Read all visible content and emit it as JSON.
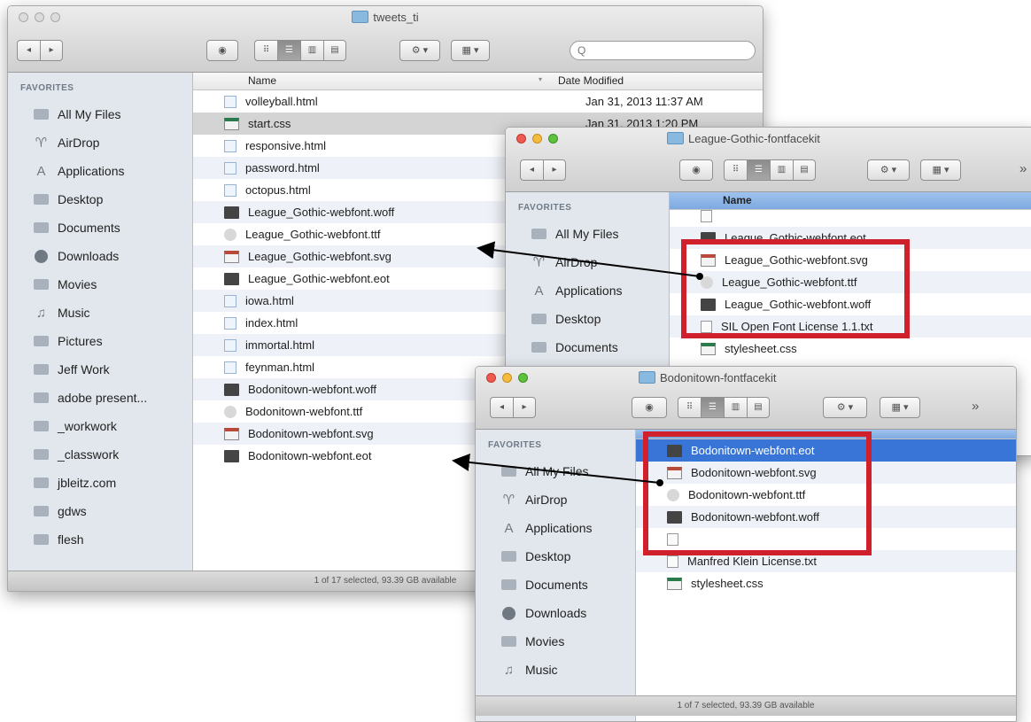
{
  "colors": {
    "highlight": "#d0202c",
    "selection": "#3875d7",
    "arrow": "#000000"
  },
  "windows": {
    "tweets": {
      "title": "tweets_ti",
      "search_placeholder": "Q",
      "favorites": "FAVORITES",
      "col_name": "Name",
      "col_date": "Date Modified",
      "sidebar": [
        {
          "label": "All My Files",
          "icon": "all-files-icon"
        },
        {
          "label": "AirDrop",
          "icon": "airdrop-icon"
        },
        {
          "label": "Applications",
          "icon": "applications-icon"
        },
        {
          "label": "Desktop",
          "icon": "desktop-icon"
        },
        {
          "label": "Documents",
          "icon": "documents-icon"
        },
        {
          "label": "Downloads",
          "icon": "downloads-icon"
        },
        {
          "label": "Movies",
          "icon": "movies-icon"
        },
        {
          "label": "Music",
          "icon": "music-icon"
        },
        {
          "label": "Pictures",
          "icon": "pictures-icon"
        },
        {
          "label": "Jeff Work",
          "icon": "folder-icon"
        },
        {
          "label": "adobe present...",
          "icon": "folder-icon"
        },
        {
          "label": "_workwork",
          "icon": "folder-icon"
        },
        {
          "label": "_classwork",
          "icon": "folder-icon"
        },
        {
          "label": "jbleitz.com",
          "icon": "folder-icon"
        },
        {
          "label": "gdws",
          "icon": "folder-icon"
        },
        {
          "label": "flesh",
          "icon": "folder-icon"
        }
      ],
      "files": [
        {
          "name": "volleyball.html",
          "date": "Jan 31, 2013 11:37 AM",
          "type": "html"
        },
        {
          "name": "start.css",
          "date": "Jan 31, 2013 1:20 PM",
          "type": "css",
          "selected": true
        },
        {
          "name": "responsive.html",
          "date": "",
          "type": "html"
        },
        {
          "name": "password.html",
          "date": "",
          "type": "html"
        },
        {
          "name": "octopus.html",
          "date": "",
          "type": "html"
        },
        {
          "name": "League_Gothic-webfont.woff",
          "date": "",
          "type": "font"
        },
        {
          "name": "League_Gothic-webfont.ttf",
          "date": "",
          "type": "ttf"
        },
        {
          "name": "League_Gothic-webfont.svg",
          "date": "",
          "type": "svg"
        },
        {
          "name": "League_Gothic-webfont.eot",
          "date": "",
          "type": "font"
        },
        {
          "name": "iowa.html",
          "date": "",
          "type": "html"
        },
        {
          "name": "index.html",
          "date": "",
          "type": "html"
        },
        {
          "name": "immortal.html",
          "date": "",
          "type": "html"
        },
        {
          "name": "feynman.html",
          "date": "",
          "type": "html"
        },
        {
          "name": "Bodonitown-webfont.woff",
          "date": "",
          "type": "font"
        },
        {
          "name": "Bodonitown-webfont.ttf",
          "date": "",
          "type": "ttf"
        },
        {
          "name": "Bodonitown-webfont.svg",
          "date": "",
          "type": "svg"
        },
        {
          "name": "Bodonitown-webfont.eot",
          "date": "",
          "type": "font"
        }
      ],
      "status": "1 of 17 selected, 93.39 GB available"
    },
    "league": {
      "title": "League-Gothic-fontfacekit",
      "favorites": "FAVORITES",
      "col_name": "Name",
      "overflow": "»",
      "sidebar": [
        {
          "label": "All My Files",
          "icon": "all-files-icon"
        },
        {
          "label": "AirDrop",
          "icon": "airdrop-icon"
        },
        {
          "label": "Applications",
          "icon": "applications-icon"
        },
        {
          "label": "Desktop",
          "icon": "desktop-icon"
        },
        {
          "label": "Documents",
          "icon": "documents-icon"
        }
      ],
      "files": [
        {
          "name": "",
          "type": "txt"
        },
        {
          "name": "League_Gothic-webfont.eot",
          "type": "font"
        },
        {
          "name": "League_Gothic-webfont.svg",
          "type": "svg"
        },
        {
          "name": "League_Gothic-webfont.ttf",
          "type": "ttf"
        },
        {
          "name": "League_Gothic-webfont.woff",
          "type": "font"
        },
        {
          "name": "SIL Open Font License 1.1.txt",
          "type": "txt"
        },
        {
          "name": "stylesheet.css",
          "type": "css"
        }
      ]
    },
    "bodoni": {
      "title": "Bodonitown-fontfacekit",
      "favorites": "FAVORITES",
      "overflow": "»",
      "sidebar": [
        {
          "label": "All My Files",
          "icon": "all-files-icon"
        },
        {
          "label": "AirDrop",
          "icon": "airdrop-icon"
        },
        {
          "label": "Applications",
          "icon": "applications-icon"
        },
        {
          "label": "Desktop",
          "icon": "desktop-icon"
        },
        {
          "label": "Documents",
          "icon": "documents-icon"
        },
        {
          "label": "Downloads",
          "icon": "downloads-icon"
        },
        {
          "label": "Movies",
          "icon": "movies-icon"
        },
        {
          "label": "Music",
          "icon": "music-icon"
        }
      ],
      "files": [
        {
          "name": "Bodonitown-webfont.eot",
          "type": "font",
          "selected": true
        },
        {
          "name": "Bodonitown-webfont.svg",
          "type": "svg"
        },
        {
          "name": "Bodonitown-webfont.ttf",
          "type": "ttf"
        },
        {
          "name": "Bodonitown-webfont.woff",
          "type": "font"
        },
        {
          "name": "",
          "type": "txt"
        },
        {
          "name": "Manfred Klein License.txt",
          "type": "txt"
        },
        {
          "name": "stylesheet.css",
          "type": "css"
        }
      ],
      "status": "1 of 7 selected, 93.39 GB available"
    }
  }
}
